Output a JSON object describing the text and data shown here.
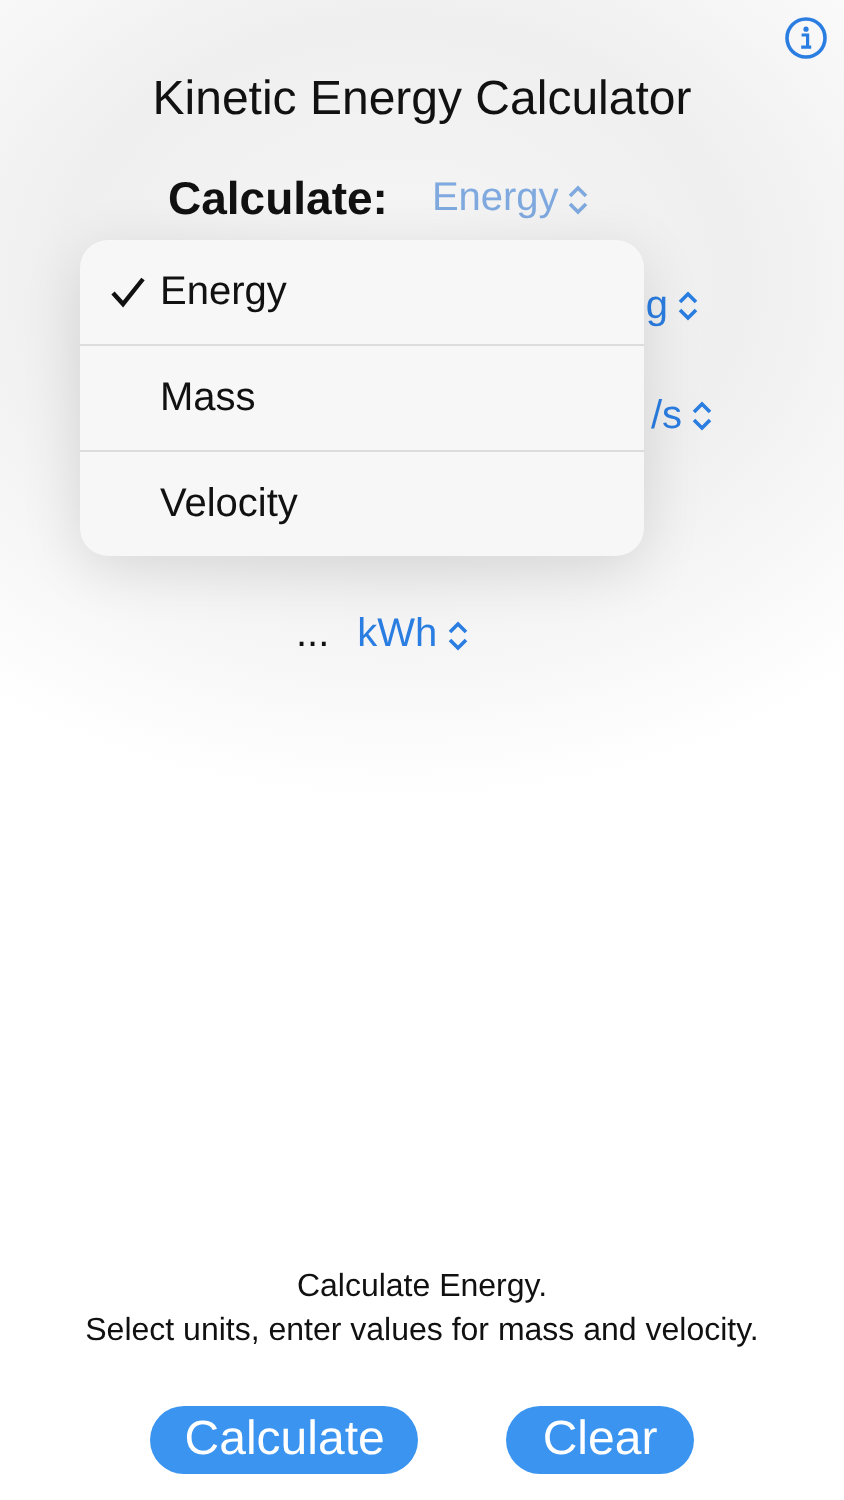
{
  "title": "Kinetic Energy Calculator",
  "calculate_row": {
    "label": "Calculate:",
    "value": "Energy"
  },
  "unit_pickers": [
    {
      "value": "g"
    },
    {
      "value": "/s"
    }
  ],
  "result_row": {
    "value": "...",
    "unit": "kWh"
  },
  "menu": {
    "items": [
      {
        "label": "Energy",
        "selected": true
      },
      {
        "label": "Mass",
        "selected": false
      },
      {
        "label": "Velocity",
        "selected": false
      }
    ]
  },
  "hint": [
    "Calculate Energy.",
    "Select units, enter values for mass and velocity."
  ],
  "buttons": [
    {
      "label": "Calculate"
    },
    {
      "label": "Clear"
    }
  ]
}
